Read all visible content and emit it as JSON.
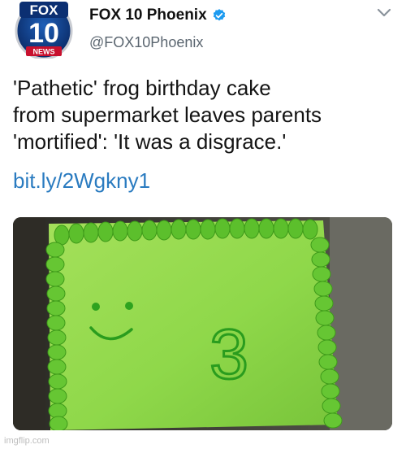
{
  "account": {
    "display_name": "FOX 10 Phoenix",
    "handle": "@FOX10Phoenix",
    "avatar_logo_text": [
      "FOX",
      "10",
      "NEWS"
    ],
    "verified": true
  },
  "tweet": {
    "text_lines": [
      "'Pathetic' frog birthday cake",
      "from supermarket leaves parents",
      "'mortified': 'It was a disgrace.'"
    ],
    "link": "bit.ly/2Wgkny1"
  },
  "media": {
    "description_icon": "cake-photo",
    "cake_number": "3"
  },
  "watermark": "imgflip.com",
  "colors": {
    "link": "#2a7bc0",
    "verified": "#1d9bf0",
    "cake_green": "#8fd84a",
    "icing_green": "#2fa020"
  },
  "icons": [
    "fox10-logo",
    "verified-badge-icon",
    "chevron-down-icon"
  ]
}
